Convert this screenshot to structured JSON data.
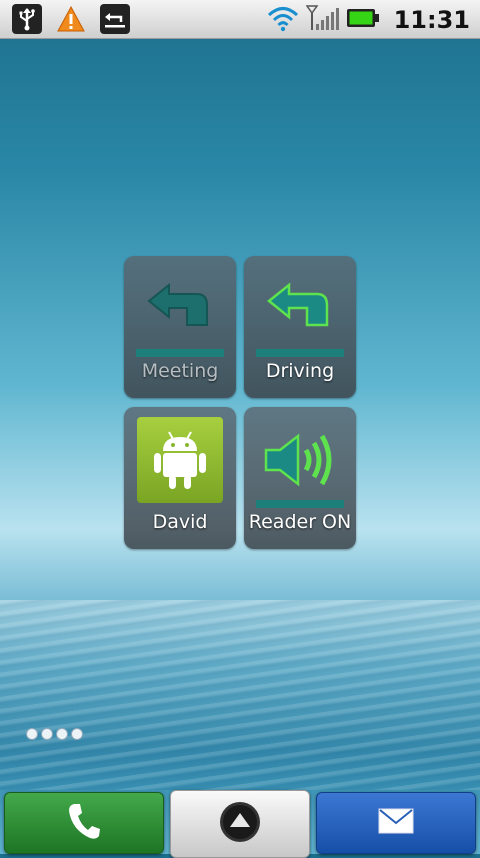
{
  "status_bar": {
    "icons": [
      "usb-icon",
      "warning-icon",
      "update-icon",
      "wifi-icon",
      "signal-icon",
      "battery-icon"
    ],
    "time": "11:31"
  },
  "widgets": [
    {
      "label": "Meeting",
      "icon": "meeting-reply-arrow-icon",
      "state": "inactive"
    },
    {
      "label": "Driving",
      "icon": "driving-reply-arrow-icon",
      "state": "active"
    },
    {
      "label": "David",
      "icon": "android-contact-icon"
    },
    {
      "label": "Reader ON",
      "icon": "speaker-icon"
    }
  ],
  "home_pages": {
    "count": 4
  },
  "dock": {
    "phone": "phone-icon",
    "launcher": "launcher-up-icon",
    "mail": "mail-icon"
  },
  "colors": {
    "accent_teal": "#1d7f7a",
    "phone_green": "#2e8e35",
    "mail_blue": "#2763c0",
    "android_green": "#a4c639"
  }
}
